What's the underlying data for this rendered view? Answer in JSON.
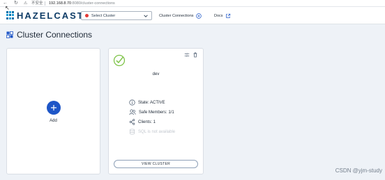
{
  "browser": {
    "security_label": "不安全",
    "url_host": "192.168.8.70",
    "url_rest": ":8080/cluster-connections"
  },
  "header": {
    "logo_text": "HAZELCAST",
    "cluster_select": {
      "selected": "Select Cluster",
      "status_color": "#e53935"
    },
    "nav": [
      {
        "label": "Cluster Connections",
        "icon": "plus-circle-icon"
      },
      {
        "label": "Docs",
        "icon": "external-link-icon"
      }
    ]
  },
  "page": {
    "title": "Cluster Connections"
  },
  "add_card": {
    "label": "Add"
  },
  "cluster_card": {
    "name": "dev",
    "status_icon": "check-circle-icon",
    "state": "State: ACTIVE",
    "safe_members": "Safe Members: 1/1",
    "clients": "Clients: 1",
    "sql": "SQL is not available",
    "view_button": "VIEW CLUSTER"
  },
  "watermark": "CSDN @yjm-study",
  "colors": {
    "accent": "#1e56c7",
    "success": "#7cc245",
    "danger": "#e53935"
  }
}
